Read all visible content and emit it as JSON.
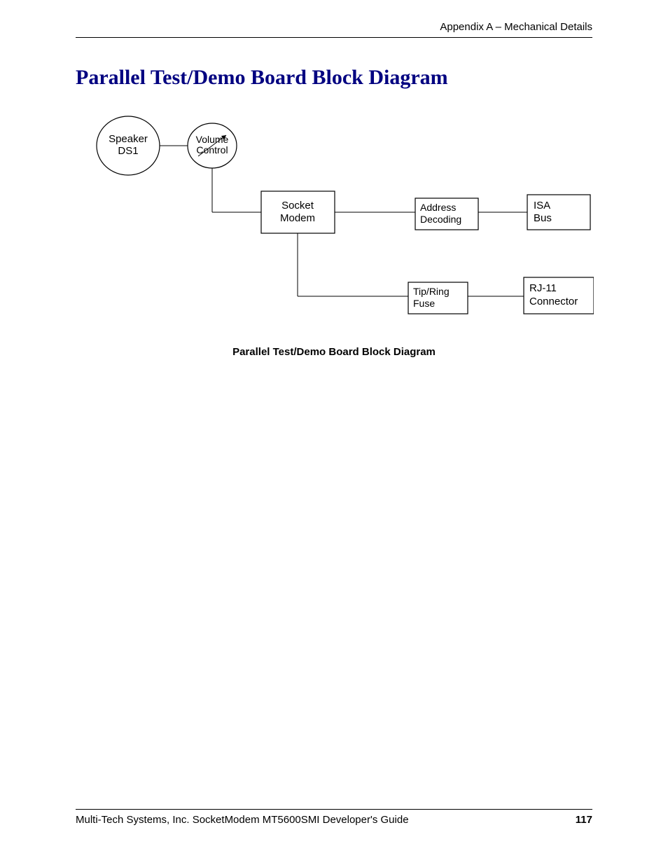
{
  "header": "Appendix A – Mechanical Details",
  "title": "Parallel Test/Demo Board Block Diagram",
  "caption": "Parallel Test/Demo Board Block Diagram",
  "footer_text": "Multi-Tech Systems, Inc. SocketModem MT5600SMI Developer's Guide",
  "page_number": "117",
  "diagram": {
    "speaker_l1": "Speaker",
    "speaker_l2": "DS1",
    "volume_l1": "Volume",
    "volume_l2": "Control",
    "socket_l1": "Socket",
    "socket_l2": "Modem",
    "address_l1": "Address",
    "address_l2": "Decoding",
    "isa_l1": "ISA",
    "isa_l2": "Bus",
    "tip_l1": "Tip/Ring",
    "tip_l2": "Fuse",
    "rj_l1": "RJ-11",
    "rj_l2": "Connector"
  }
}
